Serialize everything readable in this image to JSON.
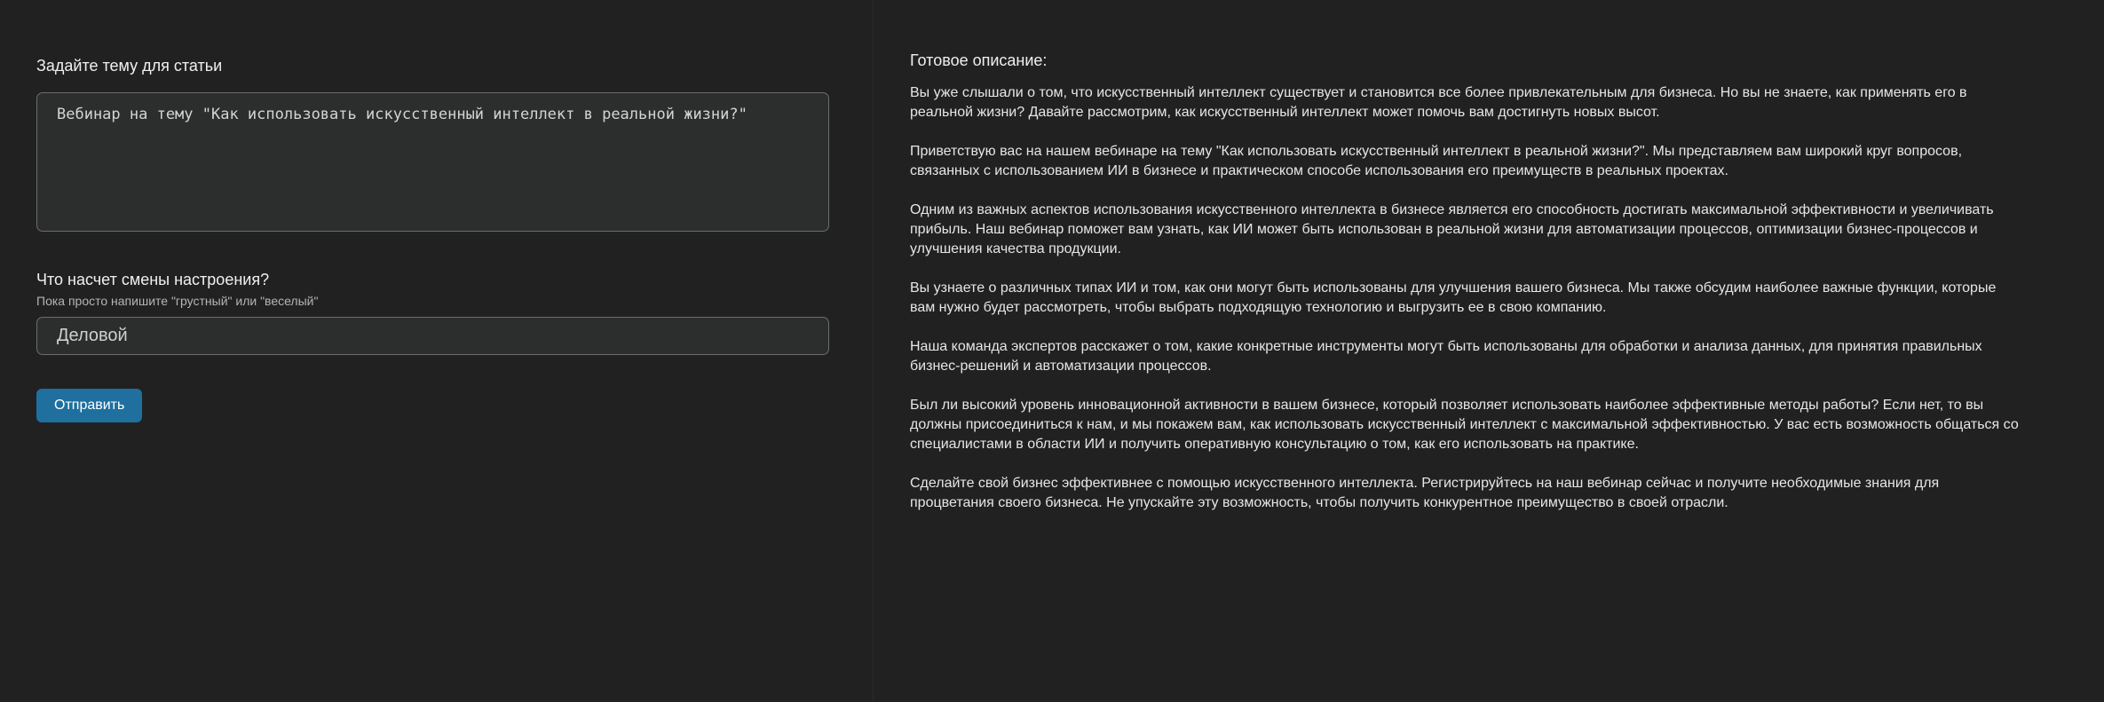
{
  "form": {
    "topic_label": "Задайте тему для статьи",
    "topic_value": "Вебинар на тему \"Как использовать искусственный интеллект в реальной жизни?\"",
    "mood_label": "Что насчет смены настроения?",
    "mood_hint": "Пока просто напишите \"грустный\" или \"веселый\"",
    "mood_value": "Деловой",
    "submit_label": "Отправить"
  },
  "result": {
    "title": "Готовое описание:",
    "paragraphs": [
      "Вы уже слышали о том, что искусственный интеллект существует и становится все более привлекательным для бизнеса. Но вы не знаете, как применять его в реальной жизни? Давайте рассмотрим, как искусственный интеллект может помочь вам достигнуть новых высот.",
      "Приветствую вас на нашем вебинаре на тему \"Как использовать искусственный интеллект в реальной жизни?\". Мы представляем вам широкий круг вопросов, связанных с использованием ИИ в бизнесе и практическом способе использования его преимуществ в реальных проектах.",
      "Одним из важных аспектов использования искусственного интеллекта в бизнесе является его способность достигать максимальной эффективности и увеличивать прибыль. Наш вебинар поможет вам узнать, как ИИ может быть использован в реальной жизни для автоматизации процессов, оптимизации бизнес-процессов и улучшения качества продукции.",
      "Вы узнаете о различных типах ИИ и том, как они могут быть использованы для улучшения вашего бизнеса. Мы также обсудим наиболее важные функции, которые вам нужно будет рассмотреть, чтобы выбрать подходящую технологию и выгрузить ее в свою компанию.",
      "Наша команда экспертов расскажет о том, какие конкретные инструменты могут быть использованы для обработки и анализа данных, для принятия правильных бизнес-решений и автоматизации процессов.",
      "Был ли высокий уровень инновационной активности в вашем бизнесе, который позволяет использовать наиболее эффективные методы работы? Если нет, то вы должны присоединиться к нам, и мы покажем вам, как использовать искусственный интеллект с максимальной эффективностью. У вас есть возможность общаться со специалистами в области ИИ и получить оперативную консультацию о том, как его использовать на практике.",
      "Сделайте свой бизнес эффективнее с помощью искусственного интеллекта. Регистрируйтесь на наш вебинар сейчас и получите необходимые знания для процветания своего бизнеса. Не упускайте эту возможность, чтобы получить конкурентное преимущество в своей отрасли."
    ]
  }
}
